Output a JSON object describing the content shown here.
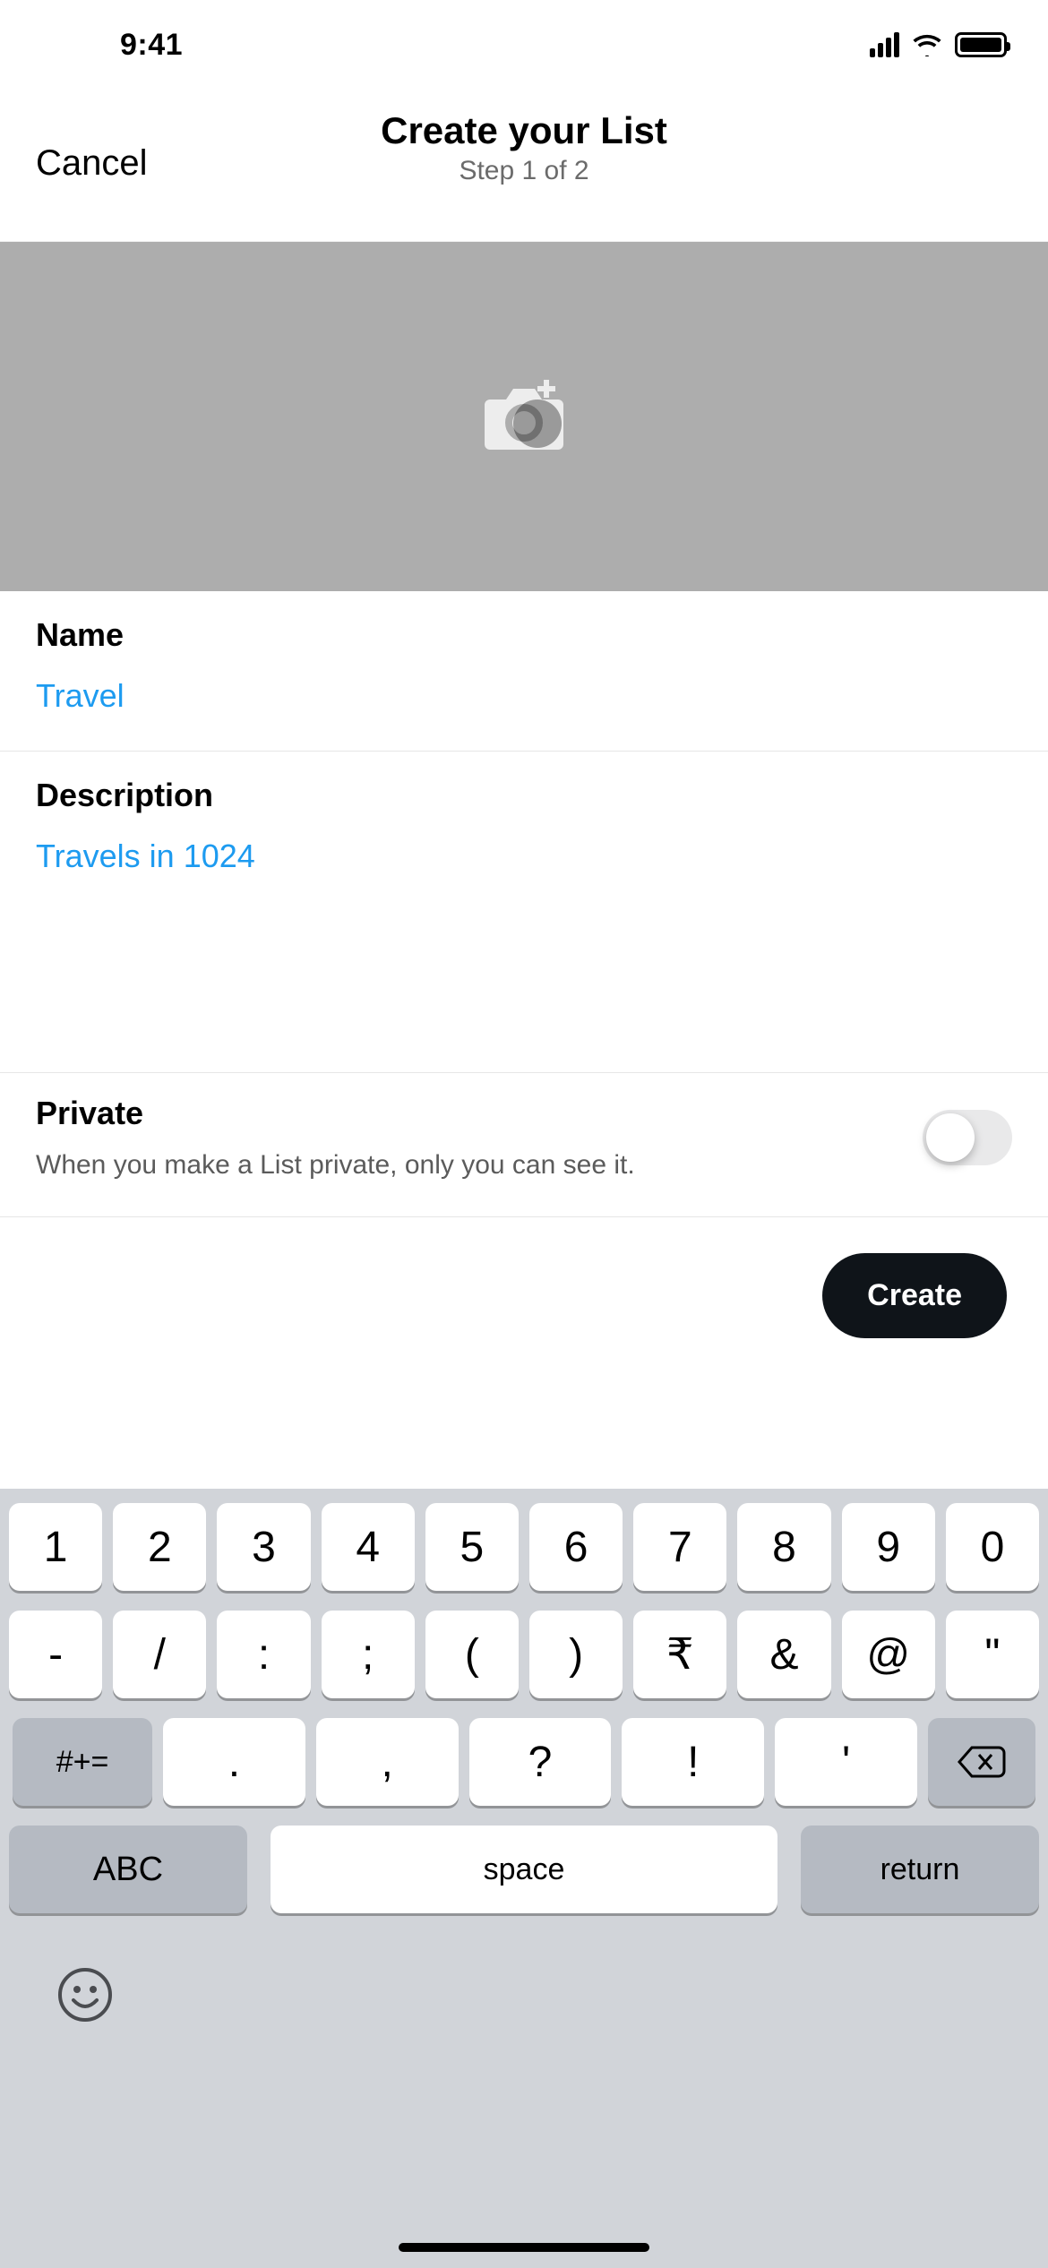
{
  "statusbar": {
    "time": "9:41"
  },
  "header": {
    "cancel_label": "Cancel",
    "title": "Create your List",
    "subtitle": "Step 1 of 2"
  },
  "form": {
    "name_label": "Name",
    "name_value": "Travel",
    "description_label": "Description",
    "description_value": "Travels in 1024"
  },
  "private": {
    "title": "Private",
    "description": "When you make a List private, only you can see it.",
    "enabled": false
  },
  "action": {
    "create_label": "Create"
  },
  "keyboard": {
    "row1": [
      "1",
      "2",
      "3",
      "4",
      "5",
      "6",
      "7",
      "8",
      "9",
      "0"
    ],
    "row2": [
      "-",
      "/",
      ":",
      ";",
      "(",
      ")",
      "₹",
      "&",
      "@",
      "\""
    ],
    "row3": {
      "sym": "#+=",
      "keys": [
        ".",
        ",",
        "?",
        "!",
        "'"
      ]
    },
    "row4": {
      "abc": "ABC",
      "space": "space",
      "return": "return"
    }
  }
}
